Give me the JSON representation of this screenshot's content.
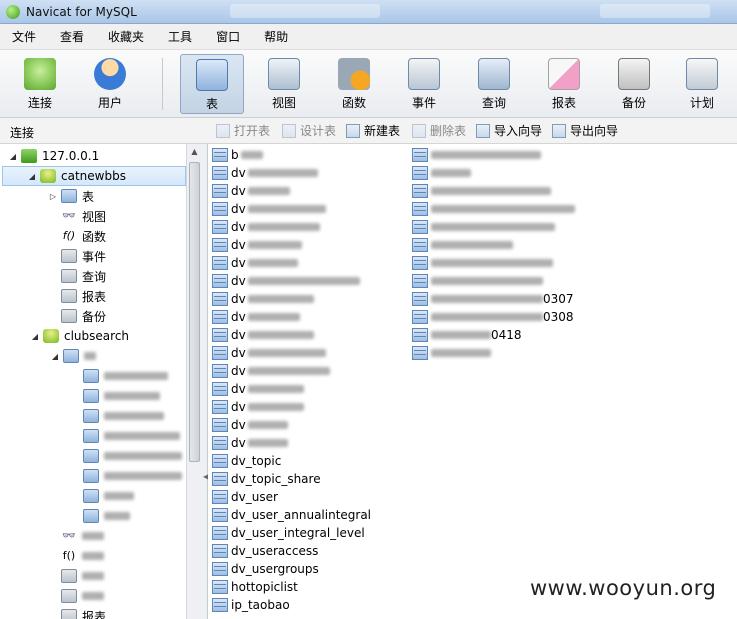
{
  "window": {
    "title": "Navicat for MySQL"
  },
  "menu": [
    "文件",
    "查看",
    "收藏夹",
    "工具",
    "窗口",
    "帮助"
  ],
  "toolbar": [
    {
      "label": "连接",
      "icon": "connection-icon"
    },
    {
      "label": "用户",
      "icon": "user-icon"
    },
    {
      "label": "表",
      "icon": "table-icon",
      "active": true
    },
    {
      "label": "视图",
      "icon": "view-icon"
    },
    {
      "label": "函数",
      "icon": "function-icon"
    },
    {
      "label": "事件",
      "icon": "event-icon"
    },
    {
      "label": "查询",
      "icon": "query-icon"
    },
    {
      "label": "报表",
      "icon": "report-icon"
    },
    {
      "label": "备份",
      "icon": "backup-icon"
    },
    {
      "label": "计划",
      "icon": "schedule-icon"
    }
  ],
  "subbar": {
    "connection_label": "连接",
    "actions": [
      {
        "label": "打开表",
        "enabled": false
      },
      {
        "label": "设计表",
        "enabled": false
      },
      {
        "label": "新建表",
        "enabled": true
      },
      {
        "label": "删除表",
        "enabled": false
      },
      {
        "label": "导入向导",
        "enabled": true
      },
      {
        "label": "导出向导",
        "enabled": true
      }
    ]
  },
  "tree": {
    "server": "127.0.0.1",
    "db1": "catnewbbs",
    "db1_children": [
      "表",
      "视图",
      "函数",
      "事件",
      "查询",
      "报表",
      "备份"
    ],
    "db2": "clubsearch",
    "db2_tail": [
      "报表"
    ]
  },
  "tables_col1": [
    "b",
    "dv",
    "dv",
    "dv",
    "dv",
    "dv",
    "dv",
    "dv",
    "dv",
    "dv",
    "dv",
    "dv",
    "dv",
    "dv",
    "dv",
    "dv",
    "dv",
    "dv_topic",
    "dv_topic_share",
    "dv_user",
    "dv_user_annualintegral",
    "dv_user_integral_level",
    "dv_useraccess",
    "dv_usergroups",
    "hottopiclist",
    "ip_taobao"
  ],
  "tables_col2_suffixes": {
    "row8": "0307",
    "row9": "0308",
    "row10": "0418"
  },
  "watermark": "www.wooyun.org"
}
